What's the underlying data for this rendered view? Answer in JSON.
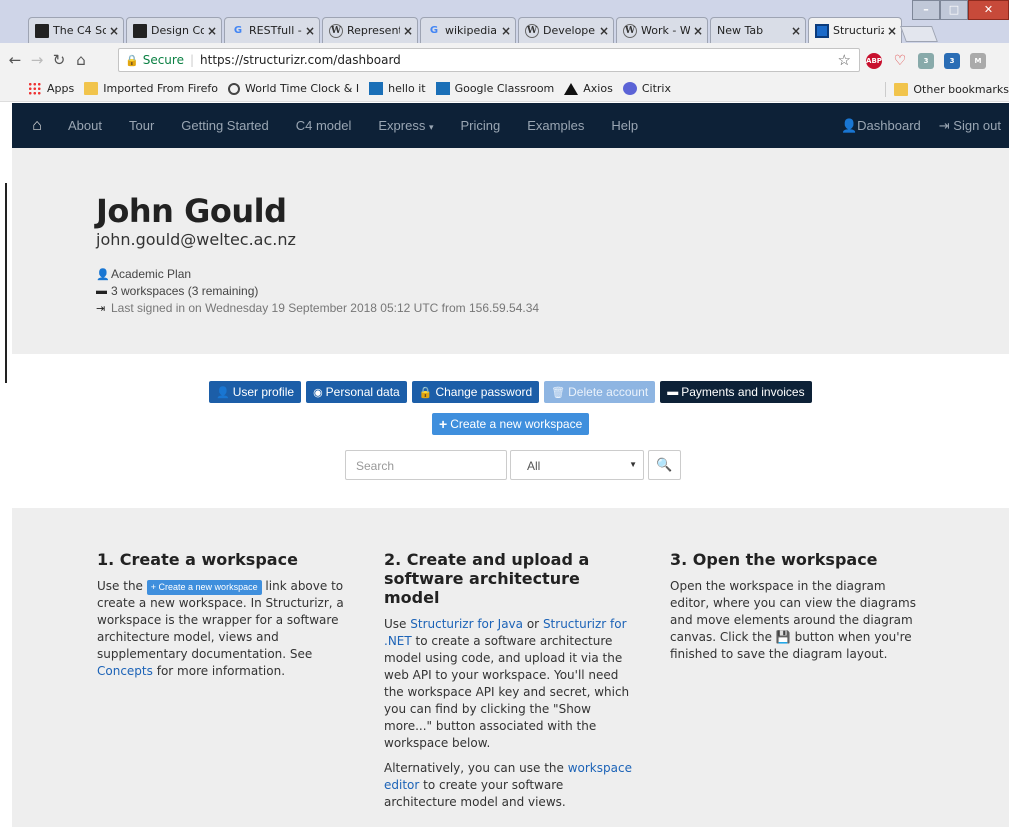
{
  "browser": {
    "tabs": [
      {
        "title": "The C4 Sc",
        "favicon": "dark-square-icon",
        "active": false
      },
      {
        "title": "Design Co",
        "favicon": "dark-square-icon",
        "active": false
      },
      {
        "title": "RESTfull -",
        "favicon": "google-icon",
        "active": false
      },
      {
        "title": "Represent",
        "favicon": "wikipedia-icon",
        "active": false
      },
      {
        "title": "wikipedia",
        "favicon": "google-icon",
        "active": false
      },
      {
        "title": "Develope",
        "favicon": "wikipedia-icon",
        "active": false
      },
      {
        "title": "Work - W",
        "favicon": "wikipedia-icon",
        "active": false
      },
      {
        "title": "New Tab",
        "favicon": "",
        "active": false
      },
      {
        "title": "Structuriz",
        "favicon": "structurizr-icon",
        "active": true
      }
    ],
    "close_glyph": "×",
    "secure_label": "Secure",
    "url": "https://structurizr.com/dashboard",
    "extensions": {
      "abp": "ABP",
      "ext_badge_1": "3",
      "ext_badge_2": "3"
    },
    "bookmarks": [
      {
        "label": "Apps",
        "icon": "apps-grid-icon"
      },
      {
        "label": "Imported From Firefo",
        "icon": "folder-icon"
      },
      {
        "label": "World Time Clock & I",
        "icon": "clock-icon"
      },
      {
        "label": "hello it",
        "icon": "classroom-icon"
      },
      {
        "label": "Google Classroom",
        "icon": "classroom-icon"
      },
      {
        "label": "Axios",
        "icon": "axios-icon"
      },
      {
        "label": "Citrix",
        "icon": "citrix-icon"
      }
    ],
    "other_bookmarks": "Other bookmarks"
  },
  "navbar": {
    "links": [
      "About",
      "Tour",
      "Getting Started",
      "C4 model",
      "Express",
      "Pricing",
      "Examples",
      "Help"
    ],
    "dashboard": "Dashboard",
    "sign_out": "Sign out"
  },
  "profile": {
    "name": "John Gould",
    "email": "john.gould@weltec.ac.nz",
    "plan": "Academic Plan",
    "workspaces": "3 workspaces (3 remaining)",
    "last_signed_in": "Last signed in on Wednesday 19 September 2018 05:12 UTC from 156.59.54.34"
  },
  "actions": {
    "user_profile": "User profile",
    "personal_data": "Personal data",
    "change_password": "Change password",
    "delete_account": "Delete account",
    "payments": "Payments and invoices",
    "create_workspace": "Create a new workspace",
    "search_placeholder": "Search",
    "filter_selected": "All"
  },
  "steps": {
    "step1": {
      "title": "1. Create a workspace",
      "use_the": "Use the",
      "button": "Create a new workspace",
      "rest": "link above to create a new workspace. In Structurizr, a workspace is the wrapper for a software architecture model, views and supplementary documentation. See",
      "concepts": "Concepts",
      "tail": "for more information."
    },
    "step2": {
      "title": "2. Create and upload a software architecture model",
      "use": "Use",
      "java": "Structurizr for Java",
      "or": "or",
      "dotnet": "Structurizr for .NET",
      "body": "to create a software architecture model using code, and upload it via the web API to your workspace. You'll need the workspace API key and secret, which you can find by clicking the \"Show more...\" button associated with the workspace below.",
      "alt": "Alternatively, you can use the",
      "editor": "workspace editor",
      "alt_tail": "to create your software architecture model and views."
    },
    "step3": {
      "title": "3. Open the workspace",
      "body1": "Open the workspace in the diagram editor, where you can view the diagrams and move elements around the diagram canvas. Click the",
      "body2": "button when you're finished to save the diagram layout."
    }
  },
  "colors": {
    "navbar_bg": "#0d2137",
    "primary_button": "#1c5ea8",
    "create_button": "#3f8fdd",
    "link": "#1c63b7"
  }
}
